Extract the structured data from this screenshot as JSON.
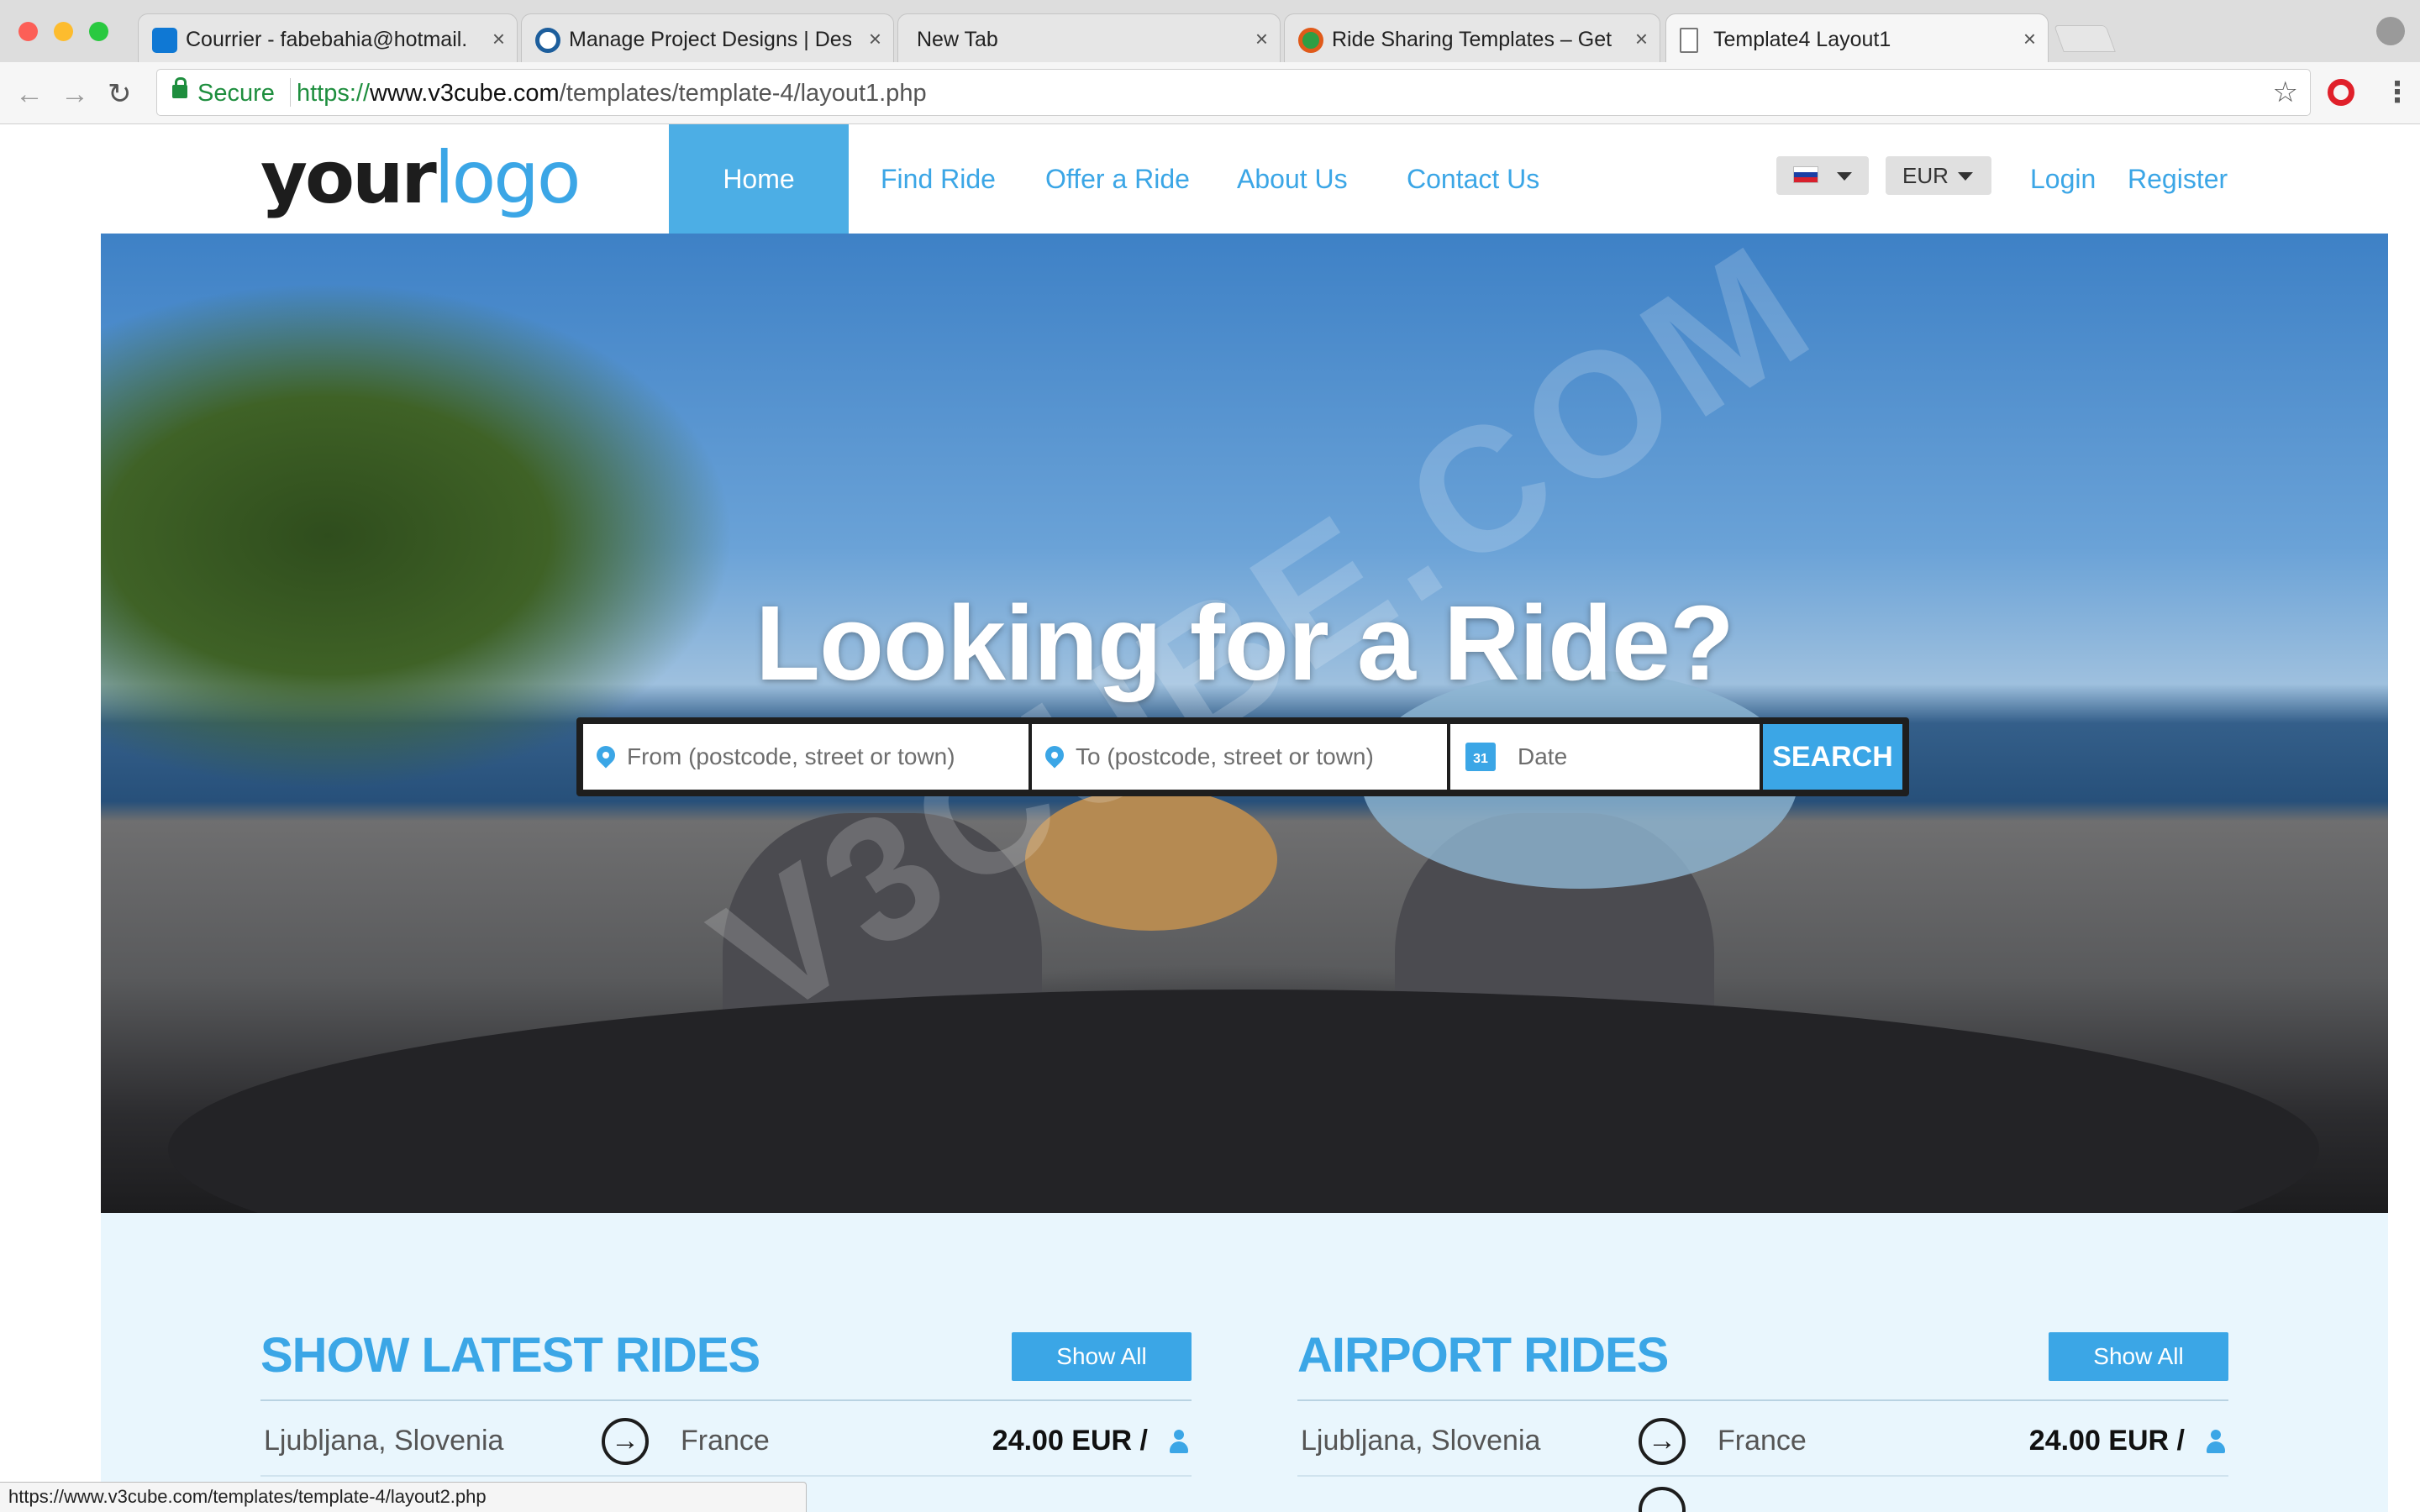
{
  "browser": {
    "tabs": [
      {
        "title": "Courrier - fabebahia@hotmail.",
        "favicon_color": "#0f78d4"
      },
      {
        "title": "Manage Project Designs | Desi",
        "favicon_color": "#1d5e9c"
      },
      {
        "title": "New Tab",
        "favicon_color": ""
      },
      {
        "title": "Ride Sharing Templates – Get",
        "favicon_color": "#2f9e44"
      },
      {
        "title": "Template4 Layout1",
        "favicon_color": "#ffffff"
      }
    ],
    "active_tab": 4,
    "close_glyph": "×",
    "secure_label": "Secure",
    "url_scheme": "https://",
    "url_host": "www.v3cube.com",
    "url_path": "/templates/template-4/layout1.php",
    "status_url": "https://www.v3cube.com/templates/template-4/layout2.php"
  },
  "site": {
    "logo_part1": "your",
    "logo_part2": "logo",
    "nav": [
      "Home",
      "Find Ride",
      "Offer a Ride",
      "About Us",
      "Contact Us"
    ],
    "language_flag": "Slovenia",
    "currency": "EUR",
    "login": "Login",
    "register": "Register"
  },
  "hero": {
    "title": "Looking for a Ride?",
    "watermark": "V3CUBE.COM",
    "search": {
      "from_placeholder": "From (postcode, street or town)",
      "to_placeholder": "To (postcode, street or town)",
      "date_placeholder": "Date",
      "calendar_day": "31",
      "button": "SEARCH"
    }
  },
  "rides": {
    "latest": {
      "title": "SHOW LATEST RIDES",
      "show_all": "Show All",
      "rows": [
        {
          "from": "Ljubljana, Slovenia",
          "to": "France",
          "price": "24.00 EUR /"
        }
      ]
    },
    "airport": {
      "title": "AIRPORT RIDES",
      "show_all": "Show All",
      "rows": [
        {
          "from": "Ljubljana, Slovenia",
          "to": "France",
          "price": "24.00 EUR /"
        }
      ]
    }
  },
  "colors": {
    "accent": "#3ba6e6",
    "nav_active": "#4caee5",
    "section_bg": "#e9f6fd",
    "secure_green": "#1e8e3e"
  },
  "icons": {
    "location": "map-pin-icon",
    "calendar": "calendar-icon",
    "route": "arrow-circle-right-icon",
    "seat": "person-icon"
  }
}
